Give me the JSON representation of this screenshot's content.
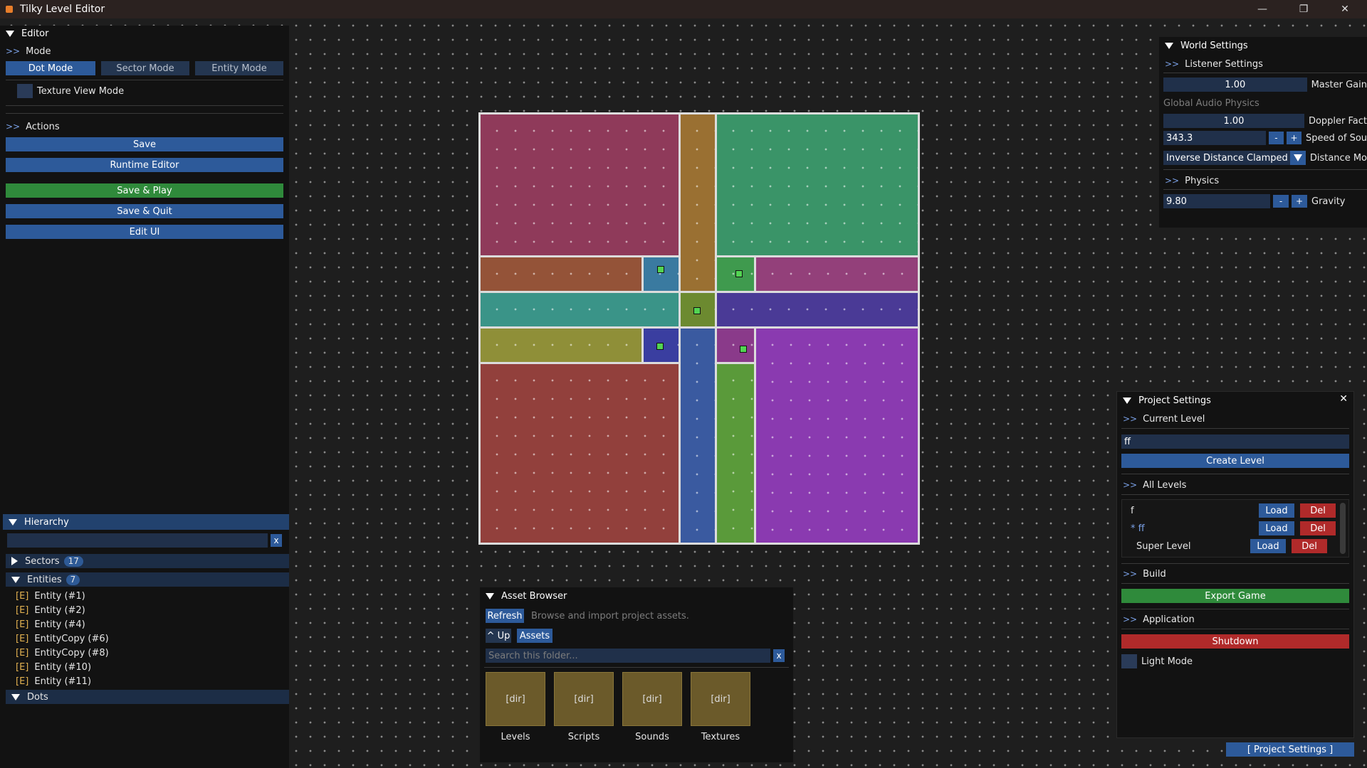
{
  "window": {
    "title": "Tilky Level Editor",
    "controls": [
      "—",
      "❐",
      "✕"
    ]
  },
  "editor": {
    "title": "Editor",
    "mode_label": "Mode",
    "modes": [
      "Dot Mode",
      "Sector Mode",
      "Entity Mode"
    ],
    "texture_view_label": "Texture View Mode",
    "actions_label": "Actions",
    "actions": [
      "Save",
      "Runtime Editor",
      "Save & Play",
      "Save & Quit",
      "Edit UI"
    ]
  },
  "hierarchy": {
    "title": "Hierarchy",
    "search_clear": "x",
    "sectors_label": "Sectors",
    "sectors_count": "17",
    "entities_label": "Entities",
    "entities_count": "7",
    "entity_tag": "[E]",
    "entities": [
      "Entity  (#1)",
      "Entity  (#2)",
      "Entity  (#4)",
      "EntityCopy  (#6)",
      "EntityCopy  (#8)",
      "Entity  (#10)",
      "Entity  (#11)"
    ],
    "dots_label": "Dots"
  },
  "world_settings": {
    "title": "World Settings",
    "listener_label": "Listener Settings",
    "master_gain_value": "1.00",
    "master_gain_label": "Master Gain",
    "global_audio_label": "Global Audio Physics",
    "doppler_value": "1.00",
    "doppler_label": "Doppler Fact",
    "speed_value": "343.3",
    "speed_label": "Speed of Sou",
    "distance_value": "Inverse Distance Clamped",
    "distance_label": "Distance Mo",
    "physics_label": "Physics",
    "gravity_value": "9.80",
    "gravity_label": "Gravity",
    "minus": "-",
    "plus": "+"
  },
  "project_settings": {
    "title": "Project Settings",
    "current_level_label": "Current Level",
    "current_level_value": "ff",
    "create_level": "Create Level",
    "all_levels_label": "All Levels",
    "levels": [
      {
        "name": "f",
        "load": "Load",
        "del": "Del"
      },
      {
        "name": "* ff",
        "load": "Load",
        "del": "Del"
      },
      {
        "name": "Super Level",
        "load": "Load",
        "del": "Del"
      }
    ],
    "build_label": "Build",
    "export_game": "Export Game",
    "application_label": "Application",
    "shutdown": "Shutdown",
    "light_mode_label": "Light Mode",
    "footer_button": "[ Project Settings ]"
  },
  "asset_browser": {
    "title": "Asset Browser",
    "refresh": "Refresh",
    "description": "Browse and import project assets.",
    "up": "^ Up",
    "path": "Assets",
    "search_placeholder": "Search this folder...",
    "search_clear": "x",
    "folders": [
      {
        "icon": "[dir]",
        "name": "Levels"
      },
      {
        "icon": "[dir]",
        "name": "Scripts"
      },
      {
        "icon": "[dir]",
        "name": "Sounds"
      },
      {
        "icon": "[dir]",
        "name": "Textures"
      }
    ]
  },
  "colors": {
    "accent": "#2d5a9a",
    "success": "#2f8a3b",
    "danger": "#b02a2a",
    "sectors": [
      "#8f3a5a",
      "#9a7032",
      "#3a9468",
      "#945338",
      "#3a7aa0",
      "#3f9a4e",
      "#93407a",
      "#3a9488",
      "#6c8a30",
      "#4a3a96",
      "#8f8f38",
      "#3a3ea0",
      "#92403c",
      "#3a5aa0",
      "#8a3a8a",
      "#5a9a3a",
      "#8a3ab0"
    ]
  }
}
